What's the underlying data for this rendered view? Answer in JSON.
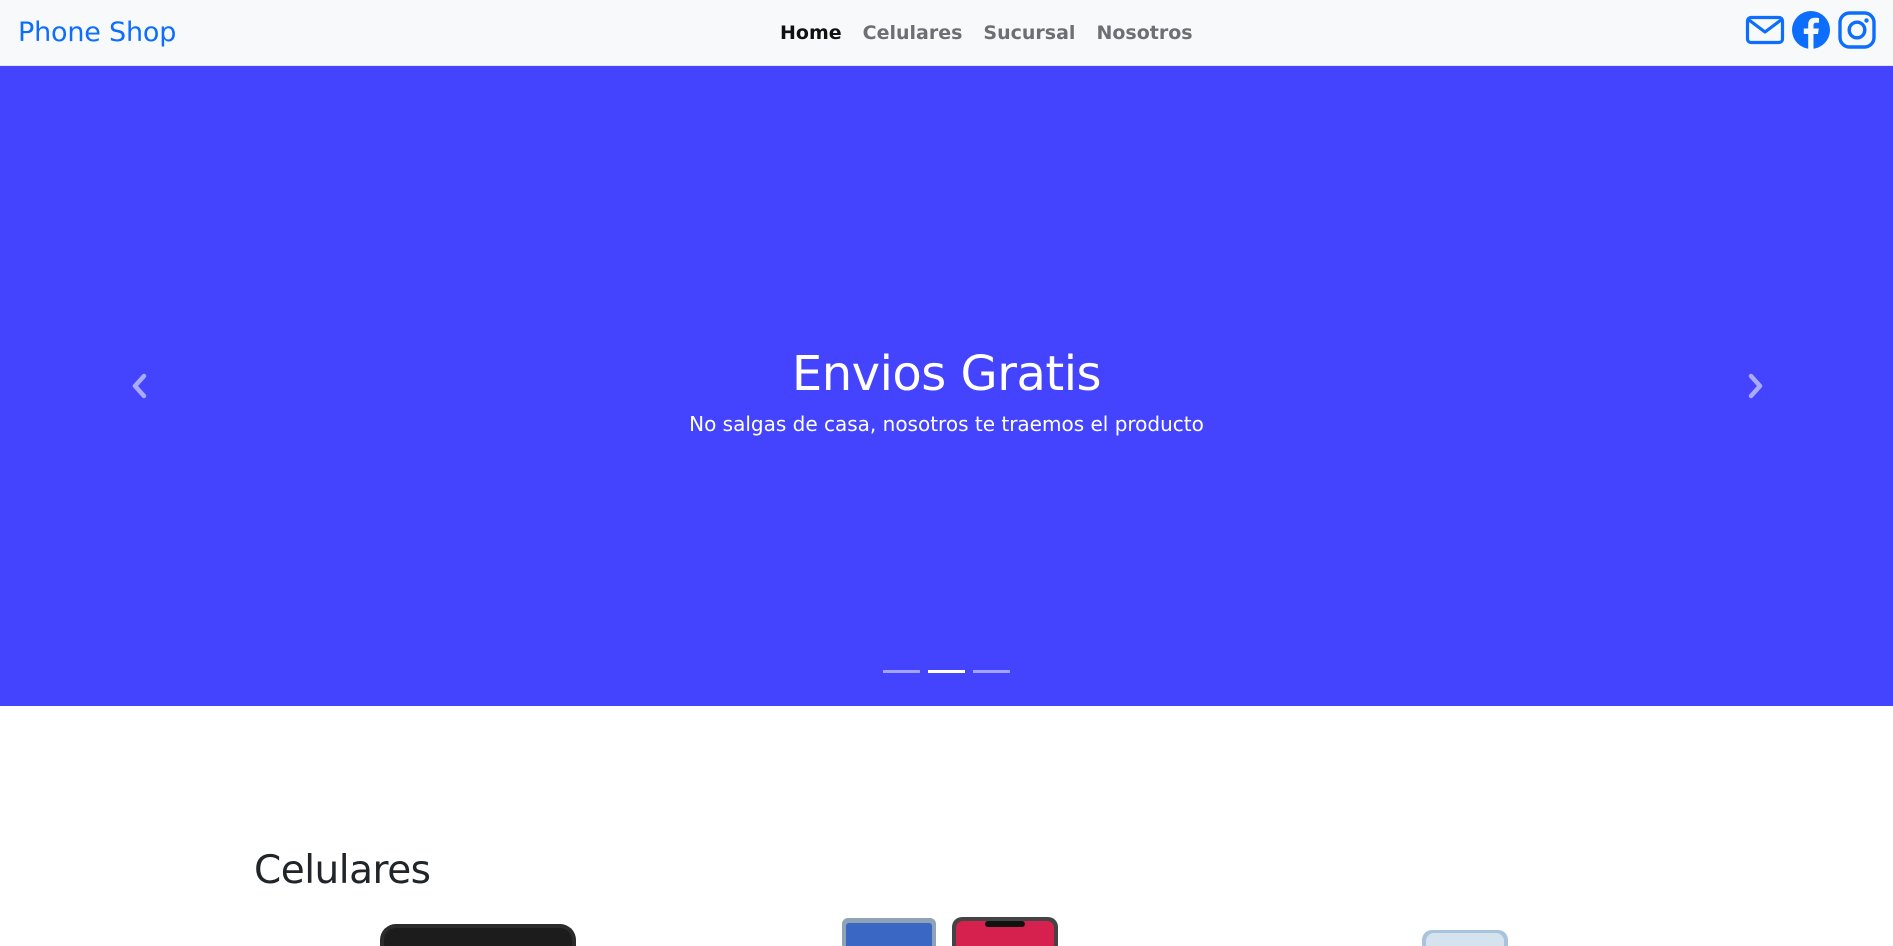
{
  "navbar": {
    "brand": "Phone Shop",
    "links": [
      {
        "label": "Home",
        "active": true
      },
      {
        "label": "Celulares",
        "active": false
      },
      {
        "label": "Sucursal",
        "active": false
      },
      {
        "label": "Nosotros",
        "active": false
      }
    ],
    "social_icons": [
      "envelope-icon",
      "facebook-icon",
      "instagram-icon"
    ],
    "brand_color": "#0d6efd"
  },
  "carousel": {
    "background_color": "#4444ff",
    "title": "Envios Gratis",
    "subtitle": "No salgas de casa, nosotros te traemos el producto",
    "slide_count": 3,
    "active_index": 1,
    "prev_icon": "chevron-left-icon",
    "next_icon": "chevron-right-icon"
  },
  "section": {
    "title": "Celulares"
  }
}
